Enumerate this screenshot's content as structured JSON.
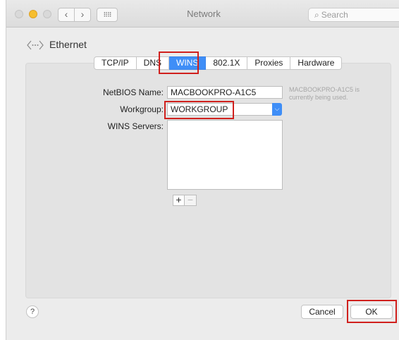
{
  "window": {
    "title": "Network"
  },
  "toolbar": {
    "back_glyph": "‹",
    "forward_glyph": "›",
    "grid_glyph": "⠿⠿",
    "search_placeholder": "Search",
    "search_icon": "magnifier-icon"
  },
  "header": {
    "service_label": "Ethernet",
    "service_icon": "ethernet-icon"
  },
  "tabs": [
    {
      "label": "TCP/IP",
      "active": false
    },
    {
      "label": "DNS",
      "active": false
    },
    {
      "label": "WINS",
      "active": true
    },
    {
      "label": "802.1X",
      "active": false
    },
    {
      "label": "Proxies",
      "active": false
    },
    {
      "label": "Hardware",
      "active": false
    }
  ],
  "form": {
    "netbios_label": "NetBIOS Name:",
    "netbios_value": "MACBOOKPRO-A1C5",
    "netbios_note": "MACBOOKPRO-A1C5 is currently being used.",
    "workgroup_label": "Workgroup:",
    "workgroup_value": "WORKGROUP",
    "wins_servers_label": "WINS Servers:",
    "wins_servers": [],
    "add_glyph": "+",
    "remove_glyph": "−"
  },
  "footer": {
    "help_glyph": "?",
    "cancel_label": "Cancel",
    "ok_label": "OK"
  },
  "colors": {
    "accent": "#3f8ef7",
    "highlight": "#d0201d"
  }
}
